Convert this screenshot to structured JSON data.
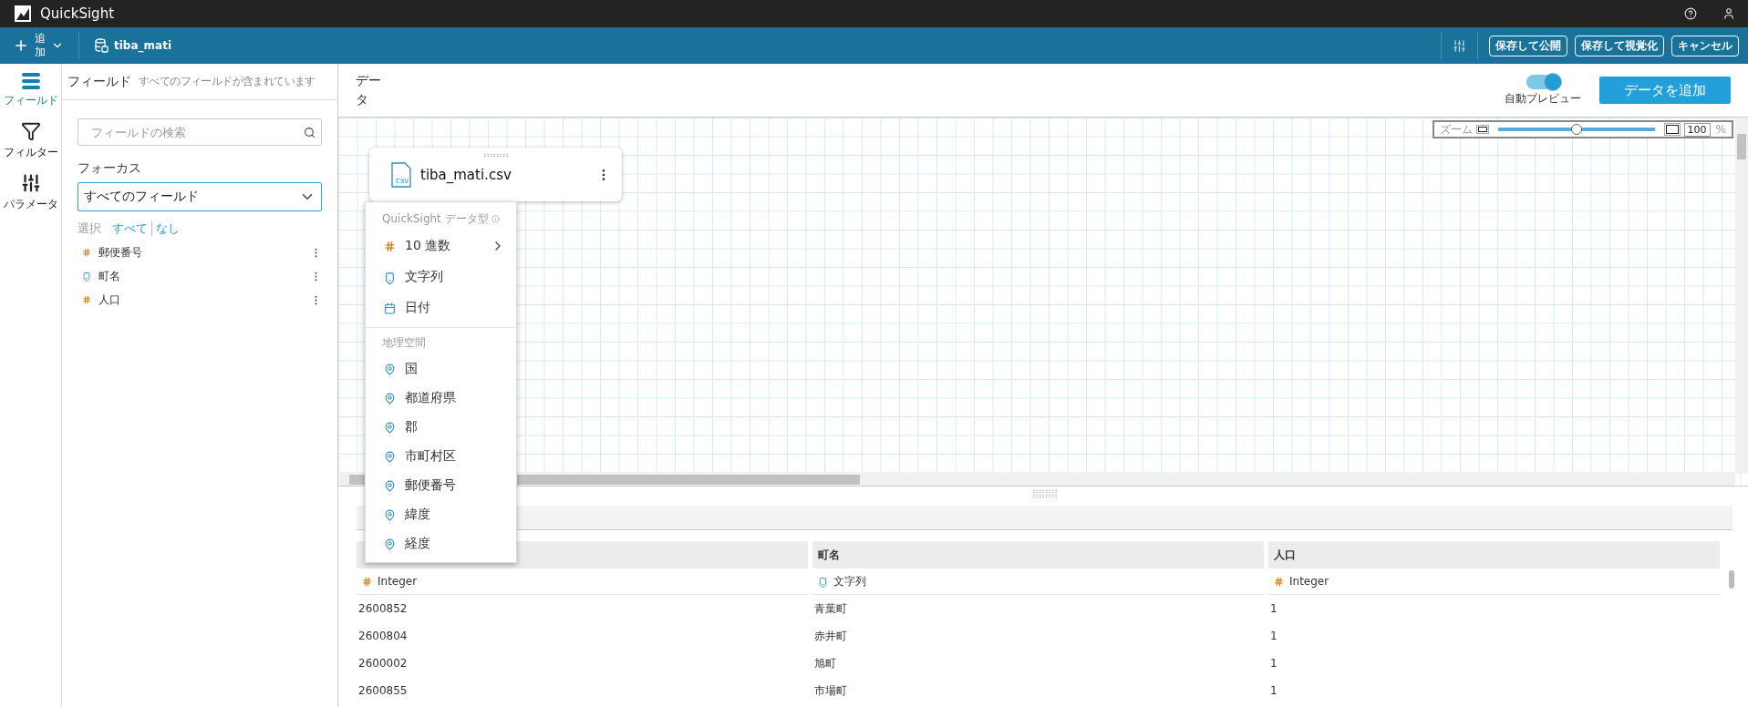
{
  "app": {
    "name": "QuickSight"
  },
  "toolbar": {
    "add_label": "追加",
    "dataset": "tiba_mati",
    "buttons": [
      "保存して公開",
      "保存して視覚化",
      "キャンセル"
    ]
  },
  "rail": [
    {
      "label": "フィールド",
      "kind": "fields",
      "selected": true
    },
    {
      "label": "フィルター",
      "kind": "filter",
      "selected": false
    },
    {
      "label": "パラメータ",
      "kind": "params",
      "selected": false
    }
  ],
  "field_panel": {
    "title": "フィールド",
    "subtitle": "すべてのフィールドが含まれています",
    "search": {
      "placeholder": "フィールドの検索"
    },
    "focus_label": "フォーカス",
    "focus_value": "すべてのフィールド",
    "select_label": "選択",
    "select_all": "すべて",
    "select_none": "なし",
    "fields": [
      {
        "name": "郵便番号",
        "kind": "number"
      },
      {
        "name": "町名",
        "kind": "string"
      },
      {
        "name": "人口",
        "kind": "number"
      }
    ]
  },
  "data_header": {
    "title": "データ",
    "auto_preview": {
      "label": "自動プレビュー",
      "on": true
    },
    "add_button": "データを追加"
  },
  "zoom": {
    "label": "ズーム",
    "level": 0.5,
    "value": "100",
    "unit": "%"
  },
  "source_card": {
    "name": "tiba_mati.csv",
    "icon_label": "CSV"
  },
  "type_menu": {
    "title": "QuickSight データ型",
    "items": [
      {
        "label": "10 進数",
        "kind": "number",
        "submenu": true
      },
      {
        "label": "文字列",
        "kind": "string",
        "submenu": false
      },
      {
        "label": "日付",
        "kind": "date",
        "submenu": false
      }
    ],
    "geo_title": "地理空間",
    "geo_items": [
      "国",
      "都道府県",
      "郡",
      "市町村区",
      "郵便番号",
      "緯度",
      "経度"
    ]
  },
  "preview": {
    "columns": [
      {
        "type": {
          "kind": "number",
          "label": "Integer"
        }
      },
      {
        "name": "町名",
        "type": {
          "kind": "string",
          "label": "文字列"
        }
      },
      {
        "name": "人口",
        "type": {
          "kind": "number",
          "label": "Integer"
        }
      }
    ],
    "rows": [
      [
        "2600852",
        "青葉町",
        "1"
      ],
      [
        "2600804",
        "赤井町",
        "1"
      ],
      [
        "2600002",
        "旭町",
        "1"
      ],
      [
        "2600855",
        "市場町",
        "1"
      ]
    ]
  }
}
